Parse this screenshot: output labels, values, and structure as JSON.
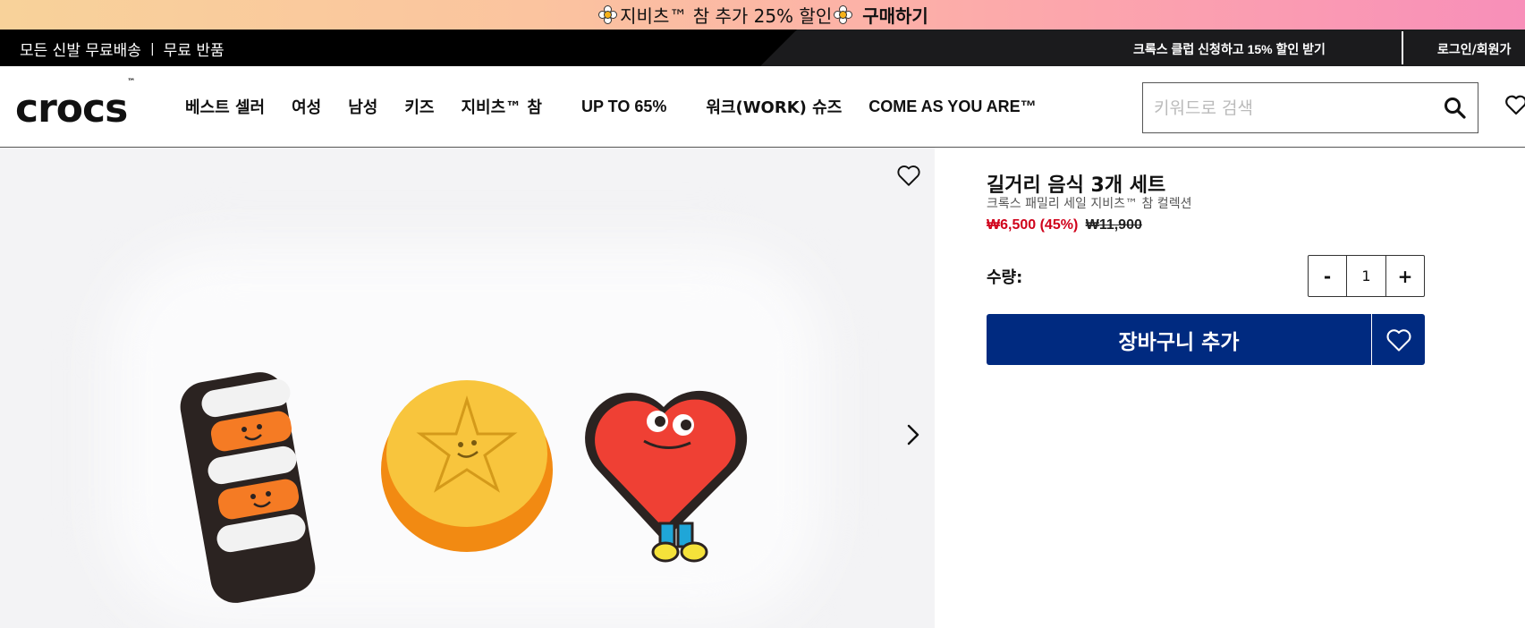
{
  "promo": {
    "text": "지비츠™ 참 추가 25% 할인",
    "cta": "구매하기"
  },
  "utility": {
    "shipping": "모든 신발 무료배송",
    "sep": "|",
    "returns": "무료 반품",
    "club": "크록스 클럽 신청하고 15% 할인 받기",
    "login": "로그인/회원가"
  },
  "nav": {
    "logo": "crocs",
    "logo_tm": "™",
    "items": [
      {
        "label": "베스트 셀러"
      },
      {
        "label": "여성"
      },
      {
        "label": "남성"
      },
      {
        "label": "키즈"
      },
      {
        "label": "지비츠™ 참"
      },
      {
        "label": "UP TO 65%"
      },
      {
        "label": "워크(WORK) 슈즈"
      },
      {
        "label": "COME AS YOU ARE™"
      }
    ],
    "search_placeholder": "키워드로 검색"
  },
  "product": {
    "title": "길거리 음식 3개 세트",
    "subtitle": "크록스 패밀리 세일 지비츠™ 참 컬렉션",
    "sale_price": "₩6,500 (45%)",
    "original_price": "₩11,900",
    "qty_label": "수량:",
    "qty_minus": "-",
    "qty_value": "1",
    "qty_plus": "+",
    "add_to_cart": "장바구니 추가"
  },
  "icons": {
    "search": "search-icon",
    "heart": "heart-icon",
    "chevron": "chevron-right-icon"
  },
  "colors": {
    "cart_button": "#002a80",
    "sale_red": "#d0021b",
    "utility_bar": "#000000"
  }
}
